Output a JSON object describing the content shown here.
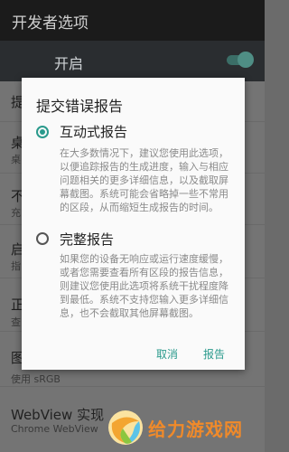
{
  "appbar": {
    "title": "开发者选项"
  },
  "master": {
    "label": "开启"
  },
  "background_items": [
    {
      "title": "提",
      "subtitle": ""
    },
    {
      "title": "桌",
      "subtitle": "桌"
    },
    {
      "title": "不",
      "subtitle": "充"
    },
    {
      "title": "启",
      "subtitle": "指"
    },
    {
      "title": "正",
      "subtitle": "查"
    },
    {
      "title": "图",
      "subtitle": "使用 sRGB"
    },
    {
      "title": "WebView 实现",
      "subtitle": "Chrome WebView"
    }
  ],
  "dialog": {
    "title": "提交错误报告",
    "options": [
      {
        "label": "互动式报告",
        "checked": true,
        "description": "在大多数情况下，建议您使用此选项，以便追踪报告的生成进度，输入与相应问题相关的更多详细信息，以及截取屏幕截图。系统可能会省略掉一些不常用的区段，从而缩短生成报告的时间。"
      },
      {
        "label": "完整报告",
        "checked": false,
        "description": "如果您的设备无响应或运行速度缓慢，或者您需要查看所有区段的报告信息，则建议您使用此选项将系统干扰程度降到最低。系统不支持您输入更多详细信息，也不会截取其他屏幕截图。"
      }
    ],
    "cancel_label": "取消",
    "confirm_label": "报告"
  },
  "watermark": {
    "text": "给力游戏网"
  },
  "colors": {
    "accent": "#2a9a8c",
    "watermark": "#f08a2a"
  }
}
